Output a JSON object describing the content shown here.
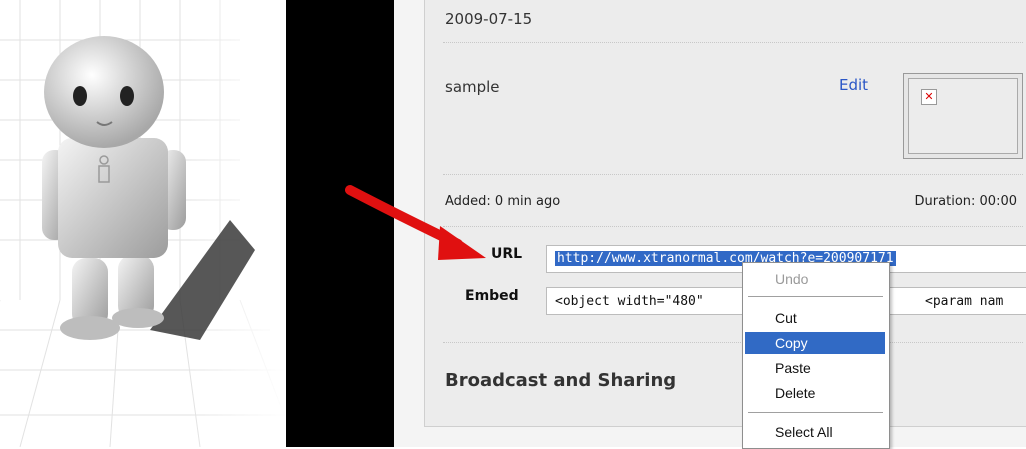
{
  "video": {
    "date": "2009-07-15",
    "title": "sample",
    "edit_label": "Edit",
    "added": "Added: 0 min ago",
    "duration": "Duration: 00:00"
  },
  "sharing": {
    "url_label": "URL",
    "url_value": "http://www.xtranormal.com/watch?e=200907171",
    "embed_label": "Embed",
    "embed_value_left": "<object width=\"480\"",
    "embed_value_right": "<param nam",
    "section_title": "Broadcast and Sharing"
  },
  "context_menu": {
    "items": [
      {
        "label": "Undo",
        "disabled": true
      },
      {
        "label": "Cut",
        "disabled": false
      },
      {
        "label": "Copy",
        "disabled": false,
        "highlighted": true
      },
      {
        "label": "Paste",
        "disabled": false
      },
      {
        "label": "Delete",
        "disabled": false
      },
      {
        "label": "Select All",
        "disabled": false
      }
    ]
  },
  "icons": {
    "broken_image": "broken-image-icon",
    "arrow": "red-arrow-icon",
    "robot": "robot-figure-icon"
  },
  "colors": {
    "link": "#2a56c6",
    "selection": "#316ac5",
    "arrow": "#e01010"
  }
}
